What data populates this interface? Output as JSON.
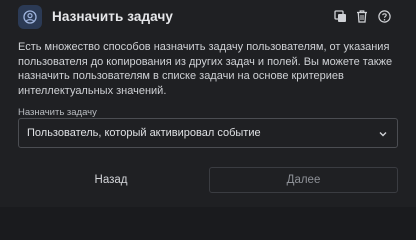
{
  "header": {
    "title": "Назначить задачу",
    "icon": "user-circle-icon",
    "actions": [
      {
        "name": "copy",
        "icon": "copy-icon"
      },
      {
        "name": "delete",
        "icon": "trash-icon"
      },
      {
        "name": "help",
        "icon": "help-icon"
      }
    ]
  },
  "description": "Есть множество способов назначить задачу пользователям, от указания пользователя до копирования из других задач и полей. Вы можете также назначить пользователям в списке задачи на основе критериев интеллектуальных значений.",
  "assign_field": {
    "label": "Назначить задачу",
    "value": "Пользователь, который активировал событие"
  },
  "footer": {
    "back_label": "Назад",
    "next_label": "Далее"
  },
  "colors": {
    "background": "#1f2023",
    "icon_badge": "#2b3a55",
    "border": "#4b4d52"
  }
}
